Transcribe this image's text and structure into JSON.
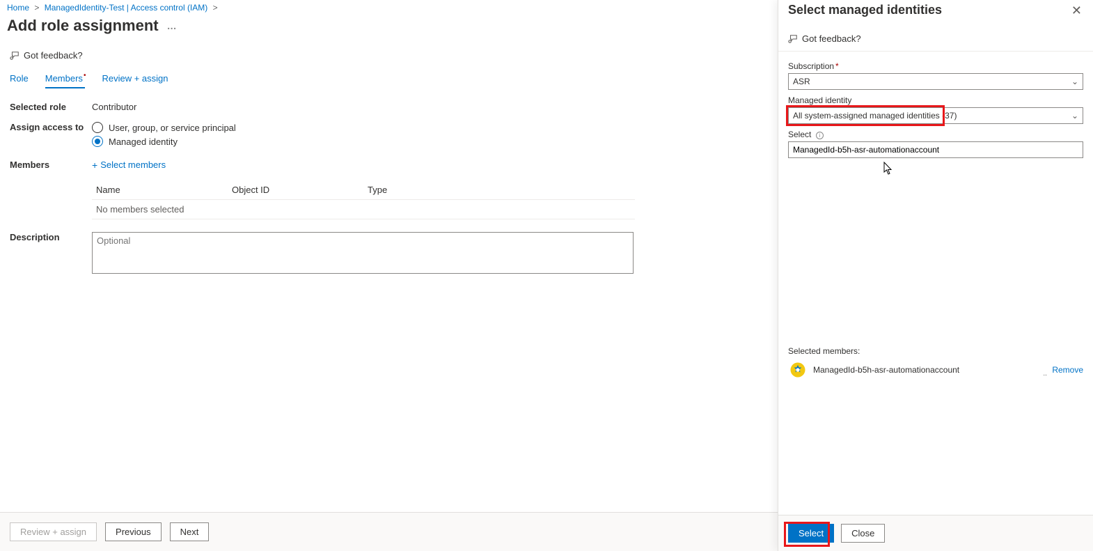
{
  "breadcrumb": {
    "home": "Home",
    "item": "ManagedIdentity-Test | Access control (IAM)"
  },
  "page": {
    "title": "Add role assignment",
    "feedback": "Got feedback?"
  },
  "tabs": {
    "role": "Role",
    "members": "Members",
    "review": "Review + assign"
  },
  "form": {
    "selected_role_label": "Selected role",
    "selected_role_value": "Contributor",
    "assign_access_label": "Assign access to",
    "radio_user": "User, group, or service principal",
    "radio_mi": "Managed identity",
    "members_label": "Members",
    "select_members": "Select members",
    "table": {
      "col_name": "Name",
      "col_obj": "Object ID",
      "col_type": "Type",
      "empty": "No members selected"
    },
    "description_label": "Description",
    "description_placeholder": "Optional"
  },
  "footer": {
    "review": "Review + assign",
    "previous": "Previous",
    "next": "Next"
  },
  "panel": {
    "title": "Select managed identities",
    "feedback": "Got feedback?",
    "subscription_label": "Subscription",
    "subscription_value": "ASR",
    "mi_label": "Managed identity",
    "mi_value": "All system-assigned managed identities (37)",
    "select_label": "Select",
    "select_value": "ManagedId-b5h-asr-automationaccount",
    "selected_heading": "Selected members:",
    "selected_name": "ManagedId-b5h-asr-automationaccount",
    "remove": "Remove",
    "btn_select": "Select",
    "btn_close": "Close"
  }
}
